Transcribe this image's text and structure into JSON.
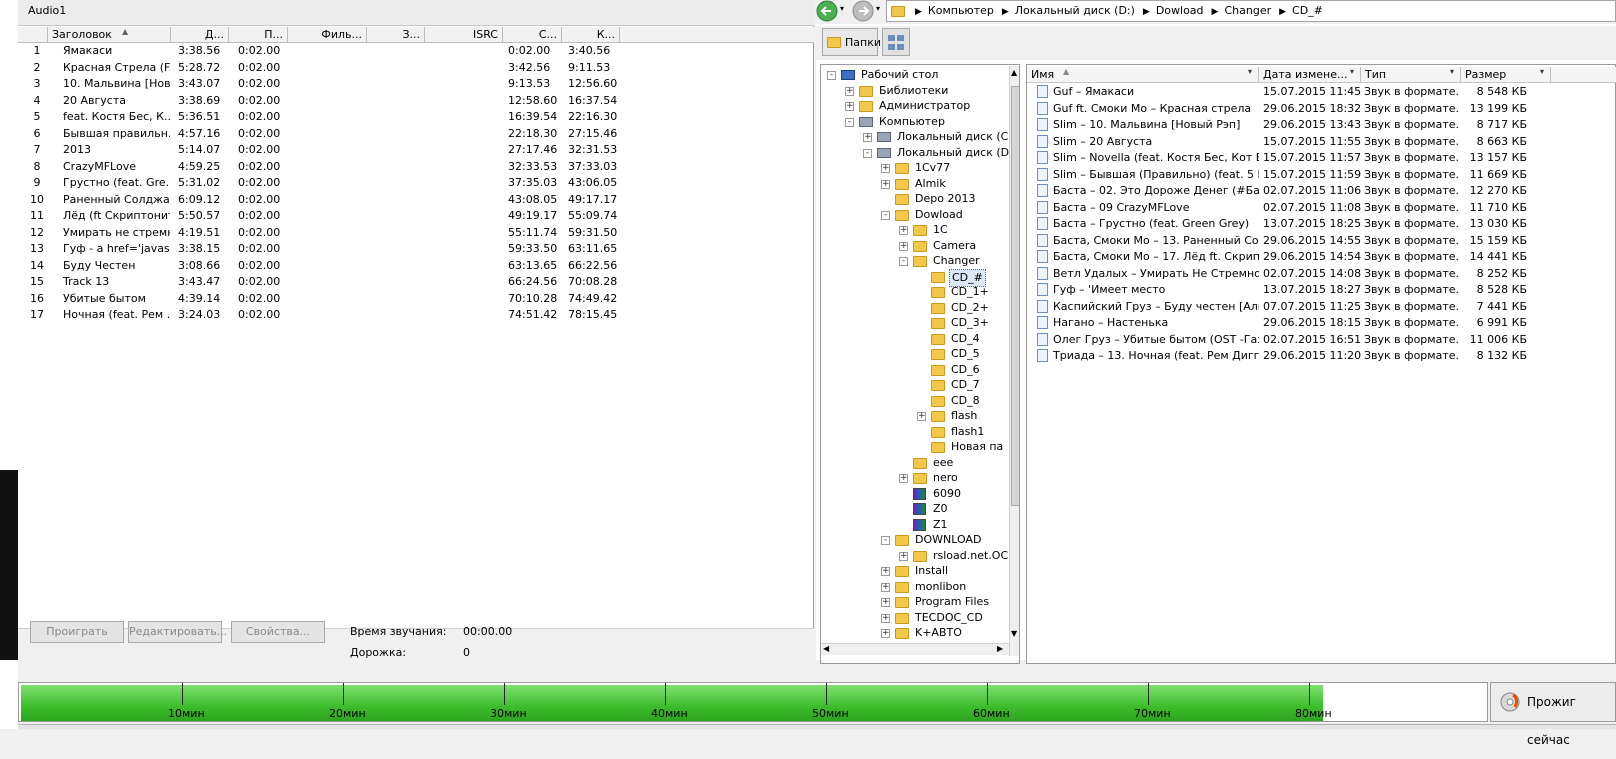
{
  "left_panel": {
    "title": "Audio1",
    "columns": [
      "Заголовок",
      "Д...",
      "П...",
      "Филь...",
      "З...",
      "ISRC",
      "С...",
      "К..."
    ],
    "tracks": [
      {
        "n": "1",
        "title": "Ямакаси",
        "dur": "3:38.56",
        "pause": "0:02.00",
        "start": "0:02.00",
        "end": "3:40.56"
      },
      {
        "n": "2",
        "title": "Красная Стрела (F...",
        "dur": "5:28.72",
        "pause": "0:02.00",
        "start": "3:42.56",
        "end": "9:11.53"
      },
      {
        "n": "3",
        "title": "10. Мальвина [Нов...",
        "dur": "3:43.07",
        "pause": "0:02.00",
        "start": "9:13.53",
        "end": "12:56.60"
      },
      {
        "n": "4",
        "title": "20 Августа",
        "dur": "3:38.69",
        "pause": "0:02.00",
        "start": "12:58.60",
        "end": "16:37.54"
      },
      {
        "n": "5",
        "title": "feat. Костя Бес, К...",
        "dur": "5:36.51",
        "pause": "0:02.00",
        "start": "16:39.54",
        "end": "22:16.30"
      },
      {
        "n": "6",
        "title": "Бывшая правильн...",
        "dur": "4:57.16",
        "pause": "0:02.00",
        "start": "22:18.30",
        "end": "27:15.46"
      },
      {
        "n": "7",
        "title": "2013",
        "dur": "5:14.07",
        "pause": "0:02.00",
        "start": "27:17.46",
        "end": "32:31.53"
      },
      {
        "n": "8",
        "title": "CrazyMFLove",
        "dur": "4:59.25",
        "pause": "0:02.00",
        "start": "32:33.53",
        "end": "37:33.03"
      },
      {
        "n": "9",
        "title": "Грустно (feat. Gre...",
        "dur": "5:31.02",
        "pause": "0:02.00",
        "start": "37:35.03",
        "end": "43:06.05"
      },
      {
        "n": "10",
        "title": "Раненный Солджа",
        "dur": "6:09.12",
        "pause": "0:02.00",
        "start": "43:08.05",
        "end": "49:17.17"
      },
      {
        "n": "11",
        "title": "Лёд (ft Скриптонит)",
        "dur": "5:50.57",
        "pause": "0:02.00",
        "start": "49:19.17",
        "end": "55:09.74"
      },
      {
        "n": "12",
        "title": "Умирать не стремн...",
        "dur": "4:19.51",
        "pause": "0:02.00",
        "start": "55:11.74",
        "end": "59:31.50"
      },
      {
        "n": "13",
        "title": "Гуф - a href='javas...",
        "dur": "3:38.15",
        "pause": "0:02.00",
        "start": "59:33.50",
        "end": "63:11.65"
      },
      {
        "n": "14",
        "title": "Буду Честен",
        "dur": "3:08.66",
        "pause": "0:02.00",
        "start": "63:13.65",
        "end": "66:22.56"
      },
      {
        "n": "15",
        "title": "Track 13",
        "dur": "3:43.47",
        "pause": "0:02.00",
        "start": "66:24.56",
        "end": "70:08.28"
      },
      {
        "n": "16",
        "title": "Убитые бытом",
        "dur": "4:39.14",
        "pause": "0:02.00",
        "start": "70:10.28",
        "end": "74:49.42"
      },
      {
        "n": "17",
        "title": "Ночная (feat. Рем ...",
        "dur": "3:24.03",
        "pause": "0:02.00",
        "start": "74:51.42",
        "end": "78:15.45"
      }
    ],
    "buttons": {
      "play": "Проиграть",
      "edit": "Редактировать...",
      "props": "Свойства..."
    },
    "info": {
      "time_label": "Время звучания:",
      "time_value": "00:00.00",
      "track_label": "Дорожка:",
      "track_value": "0"
    }
  },
  "explorer": {
    "breadcrumb": [
      "Компьютер",
      "Локальный диск (D:)",
      "Dowload",
      "Changer",
      "CD_#"
    ],
    "folders_button": "Папки",
    "tree": [
      {
        "label": "Рабочий стол",
        "level": 0,
        "exp": "-"
      },
      {
        "label": "Библиотеки",
        "level": 1,
        "exp": "+"
      },
      {
        "label": "Администратор",
        "level": 1,
        "exp": "+"
      },
      {
        "label": "Компьютер",
        "level": 1,
        "exp": "-"
      },
      {
        "label": "Локальный диск (C:)",
        "level": 2,
        "exp": "+"
      },
      {
        "label": "Локальный диск (D:)",
        "level": 2,
        "exp": "-"
      },
      {
        "label": "1Cv77",
        "level": 3,
        "exp": "+"
      },
      {
        "label": "Almik",
        "level": 3,
        "exp": "+"
      },
      {
        "label": "Depo 2013",
        "level": 3,
        "exp": ""
      },
      {
        "label": "Dowload",
        "level": 3,
        "exp": "-"
      },
      {
        "label": "1C",
        "level": 4,
        "exp": "+"
      },
      {
        "label": "Camera",
        "level": 4,
        "exp": "+"
      },
      {
        "label": "Changer",
        "level": 4,
        "exp": "-"
      },
      {
        "label": "CD_#",
        "level": 5,
        "exp": "",
        "selected": true
      },
      {
        "label": "CD_1+",
        "level": 5,
        "exp": ""
      },
      {
        "label": "CD_2+",
        "level": 5,
        "exp": ""
      },
      {
        "label": "CD_3+",
        "level": 5,
        "exp": ""
      },
      {
        "label": "CD_4",
        "level": 5,
        "exp": ""
      },
      {
        "label": "CD_5",
        "level": 5,
        "exp": ""
      },
      {
        "label": "CD_6",
        "level": 5,
        "exp": ""
      },
      {
        "label": "CD_7",
        "level": 5,
        "exp": ""
      },
      {
        "label": "CD_8",
        "level": 5,
        "exp": ""
      },
      {
        "label": "flash",
        "level": 5,
        "exp": "+"
      },
      {
        "label": "flash1",
        "level": 5,
        "exp": ""
      },
      {
        "label": "Новая па",
        "level": 5,
        "exp": ""
      },
      {
        "label": "eee",
        "level": 4,
        "exp": ""
      },
      {
        "label": "nero",
        "level": 4,
        "exp": "+"
      },
      {
        "label": "6090",
        "level": 4,
        "exp": "",
        "archive": true
      },
      {
        "label": "Z0",
        "level": 4,
        "exp": "",
        "archive": true
      },
      {
        "label": "Z1",
        "level": 4,
        "exp": "",
        "archive": true
      },
      {
        "label": "DOWNLOAD",
        "level": 3,
        "exp": "-"
      },
      {
        "label": "rsload.net.OC",
        "level": 4,
        "exp": "+"
      },
      {
        "label": "Install",
        "level": 3,
        "exp": "+"
      },
      {
        "label": "monlibon",
        "level": 3,
        "exp": "+"
      },
      {
        "label": "Program Files",
        "level": 3,
        "exp": "+"
      },
      {
        "label": "TECDOC_CD",
        "level": 3,
        "exp": "+"
      },
      {
        "label": "K+АВТО",
        "level": 3,
        "exp": "+"
      }
    ],
    "file_columns": [
      "Имя",
      "Дата измене...",
      "Тип",
      "Размер"
    ],
    "files": [
      {
        "name": "Guf – Ямакаси",
        "date": "15.07.2015 11:45",
        "type": "Звук в формате...",
        "size": "8 548 КБ"
      },
      {
        "name": "Guf ft. Смоки Мо – Красная стрела",
        "date": "29.06.2015 18:32",
        "type": "Звук в формате...",
        "size": "13 199 КБ"
      },
      {
        "name": "Slim – 10. Мальвина [Новый Рэп]",
        "date": "29.06.2015 13:43",
        "type": "Звук в формате...",
        "size": "8 717 КБ"
      },
      {
        "name": "Slim – 20 Августа",
        "date": "15.07.2015 11:55",
        "type": "Звук в формате...",
        "size": "8 663 КБ"
      },
      {
        "name": "Slim – Novella (feat. Костя Бес, Кот Балу)",
        "date": "15.07.2015 11:57",
        "type": "Звук в формате...",
        "size": "13 157 КБ"
      },
      {
        "name": "Slim – Бывшая (Правильно) (feat. 5 Пл...",
        "date": "15.07.2015 11:59",
        "type": "Звук в формате...",
        "size": "11 669 КБ"
      },
      {
        "name": "Баста – 02. Это Дороже Денег (#Баст...",
        "date": "02.07.2015 11:06",
        "type": "Звук в формате...",
        "size": "12 270 КБ"
      },
      {
        "name": "Баста – 09 CrazyMFLove",
        "date": "02.07.2015 11:08",
        "type": "Звук в формате...",
        "size": "11 710 КБ"
      },
      {
        "name": "Баста – Грустно (feat. Green Grey)",
        "date": "13.07.2015 18:25",
        "type": "Звук в формате...",
        "size": "13 030 КБ"
      },
      {
        "name": "Баста, Смоки Мо – 13. Раненный Солджа",
        "date": "29.06.2015 14:55",
        "type": "Звук в формате...",
        "size": "15 159 КБ"
      },
      {
        "name": "Баста, Смоки Мо – 17. Лёд ft. Скрипто...",
        "date": "29.06.2015 14:54",
        "type": "Звук в формате...",
        "size": "14 441 КБ"
      },
      {
        "name": "Ветл Удалых – Умирать Не Стремно (f...",
        "date": "02.07.2015 14:08",
        "type": "Звук в формате...",
        "size": "8 252 КБ"
      },
      {
        "name": "Гуф – 'Имеет место",
        "date": "13.07.2015 18:27",
        "type": "Звук в формате...",
        "size": "8 528 КБ"
      },
      {
        "name": "Каспийский Груз – Буду честен [Альбо...",
        "date": "07.07.2015 11:25",
        "type": "Звук в формате...",
        "size": "7 441 КБ"
      },
      {
        "name": "Нагано – Настенька",
        "date": "29.06.2015 18:15",
        "type": "Звук в формате...",
        "size": "6 991 КБ"
      },
      {
        "name": "Олег Груз – Убитые бытом (OST -Газг...",
        "date": "02.07.2015 16:51",
        "type": "Звук в формате...",
        "size": "11 006 КБ"
      },
      {
        "name": "Триада – 13. Ночная (feat. Рем Дигга)",
        "date": "29.06.2015 11:20",
        "type": "Звук в формате...",
        "size": "8 132 КБ"
      }
    ]
  },
  "capacity": {
    "fill_fraction": 0.8,
    "ticks": [
      "10мин",
      "20мин",
      "30мин",
      "40мин",
      "50мин",
      "60мин",
      "70мин",
      "80мин"
    ],
    "burn_button": "Прожиг сейчас",
    "fill_color": "#3cbd2b"
  }
}
